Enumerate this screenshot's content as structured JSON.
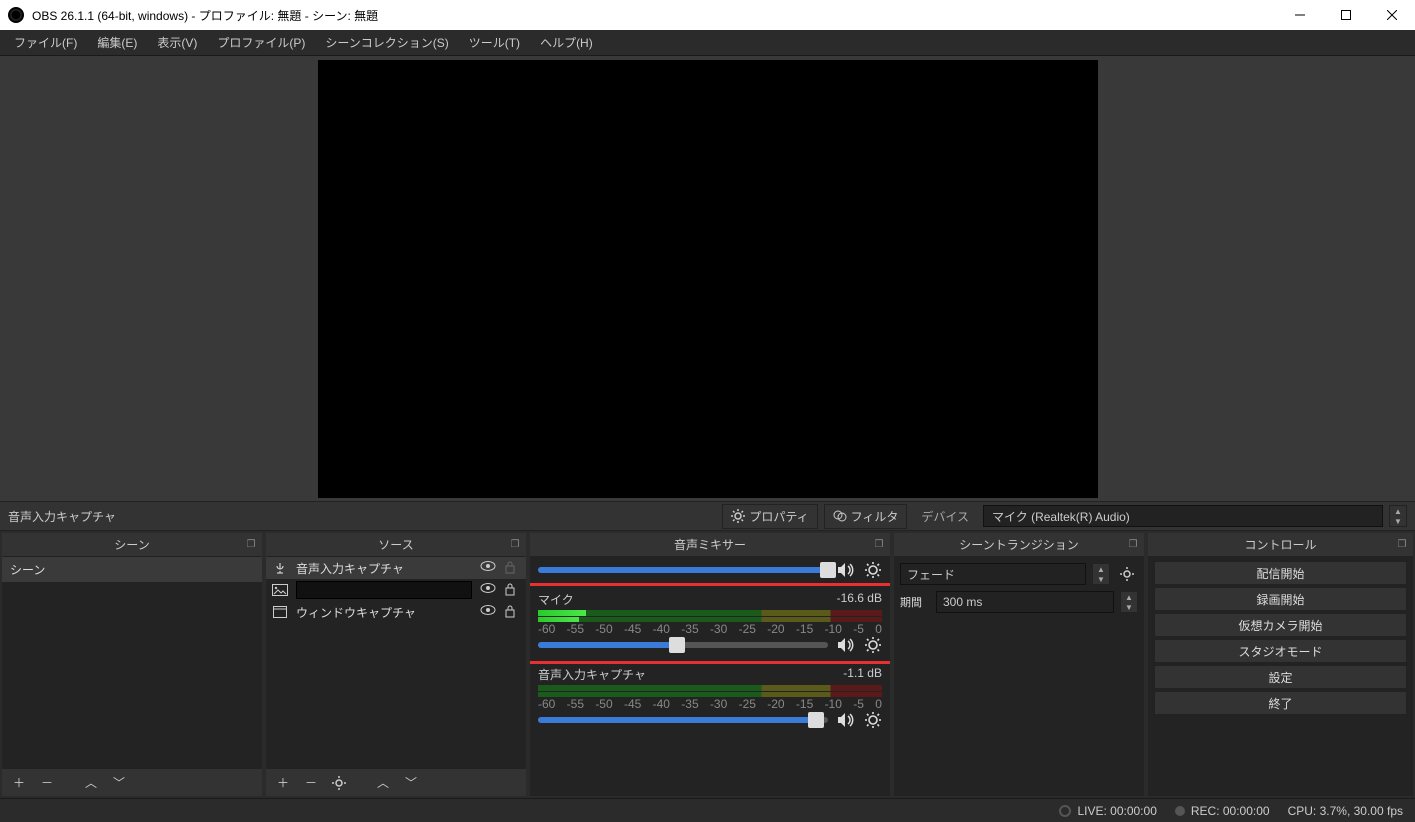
{
  "window": {
    "title": "OBS 26.1.1 (64-bit, windows) - プロファイル: 無題 - シーン: 無題"
  },
  "menu": {
    "file": "ファイル(F)",
    "edit": "編集(E)",
    "view": "表示(V)",
    "profile": "プロファイル(P)",
    "scenecol": "シーンコレクション(S)",
    "tools": "ツール(T)",
    "help": "ヘルプ(H)"
  },
  "propbar": {
    "selected_source": "音声入力キャプチャ",
    "properties": "プロパティ",
    "filters": "フィルタ",
    "device_label": "デバイス",
    "device_value": "マイク (Realtek(R) Audio)"
  },
  "panels": {
    "scenes": {
      "title": "シーン",
      "items": [
        {
          "name": "シーン"
        }
      ]
    },
    "sources": {
      "title": "ソース",
      "items": [
        {
          "name": "音声入力キャプチャ",
          "selected": true,
          "type": "audioin"
        },
        {
          "name": "",
          "editing": true,
          "type": "image"
        },
        {
          "name": "ウィンドウキャプチャ",
          "type": "window"
        }
      ]
    },
    "mixer": {
      "title": "音声ミキサー",
      "ticks": [
        "-60",
        "-55",
        "-50",
        "-45",
        "-40",
        "-35",
        "-30",
        "-25",
        "-20",
        "-15",
        "-10",
        "-5",
        "0"
      ],
      "channels": [
        {
          "name": "",
          "db": "",
          "slider_pct": 100,
          "level_pct": 0,
          "highlighted": false
        },
        {
          "name": "マイク",
          "db": "-16.6 dB",
          "slider_pct": 48,
          "level_pct": 14,
          "highlighted": true
        },
        {
          "name": "音声入力キャプチャ",
          "db": "-1.1 dB",
          "slider_pct": 96,
          "level_pct": 0,
          "highlighted": false
        }
      ]
    },
    "transitions": {
      "title": "シーントランジション",
      "value": "フェード",
      "duration_label": "期間",
      "duration_value": "300 ms"
    },
    "controls": {
      "title": "コントロール",
      "buttons": [
        "配信開始",
        "録画開始",
        "仮想カメラ開始",
        "スタジオモード",
        "設定",
        "終了"
      ]
    }
  },
  "status": {
    "live": "LIVE: 00:00:00",
    "rec": "REC: 00:00:00",
    "cpu": "CPU: 3.7%, 30.00 fps"
  }
}
